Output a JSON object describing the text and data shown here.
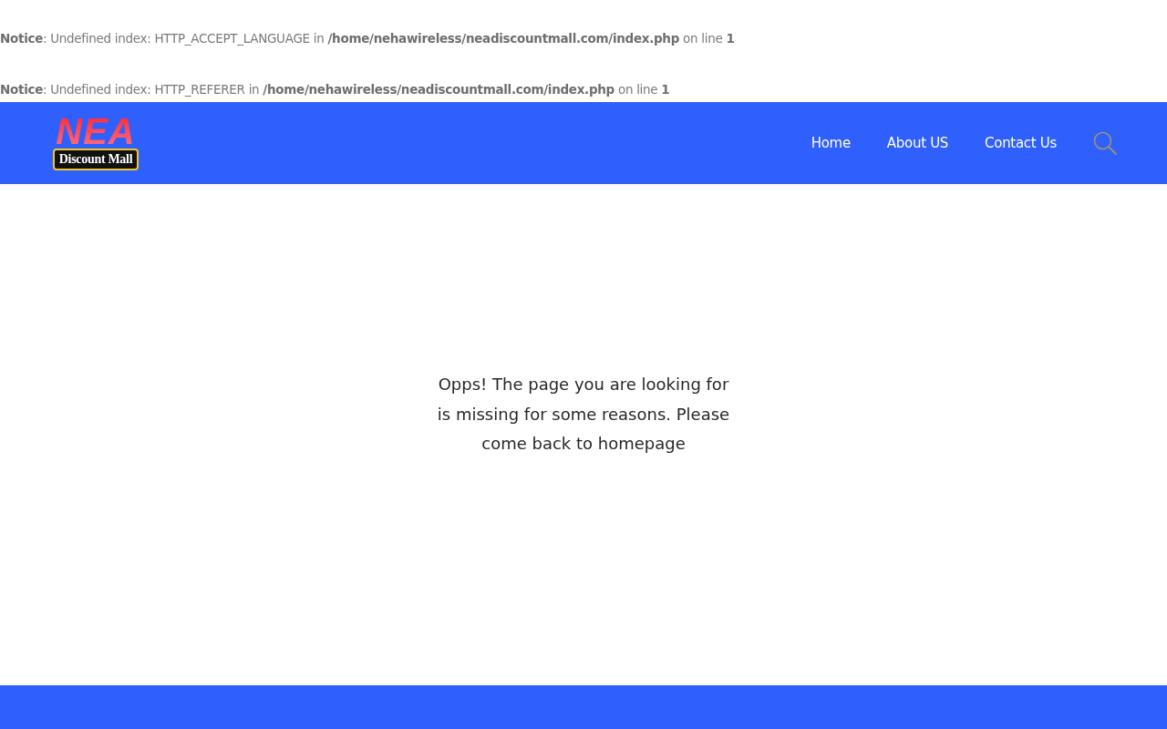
{
  "notices": [
    {
      "text": "**Notice**: Undefined index: HTTP_ACCEPT_LANGUAGE in **/home/nehawireless/neadiscountmall.com/index.php** on line **1**"
    },
    {
      "text": "**Notice**: Undefined index: HTTP_REFERER in **/home/nehawireless/neadiscountmall.com/index.php** on line **1**"
    }
  ],
  "header": {
    "logo": {
      "title": "NEA",
      "tagline": "Discount Mall"
    },
    "nav": [
      {
        "label": "Home"
      },
      {
        "label": "About US"
      },
      {
        "label": "Contact Us"
      }
    ]
  },
  "message": "Opps! The page you are looking for is missing for some reasons. Please come back to homepage"
}
